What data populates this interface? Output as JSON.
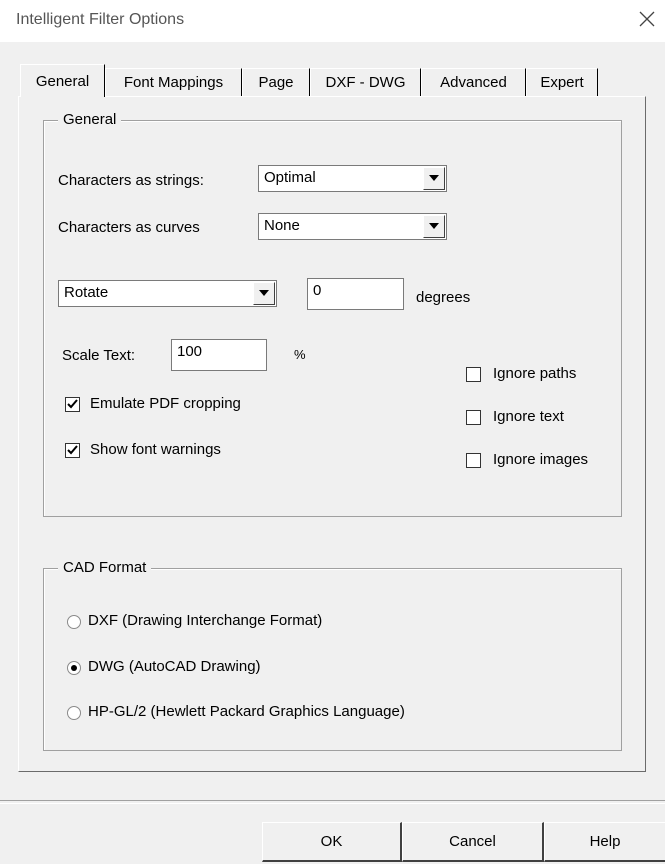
{
  "window": {
    "title": "Intelligent Filter Options"
  },
  "tabs": [
    {
      "label": "General",
      "active": true
    },
    {
      "label": "Font Mappings"
    },
    {
      "label": "Page"
    },
    {
      "label": "DXF - DWG"
    },
    {
      "label": "Advanced"
    },
    {
      "label": "Expert"
    }
  ],
  "general_group": {
    "title": "General",
    "chars_as_strings": {
      "label": "Characters as strings:",
      "value": "Optimal"
    },
    "chars_as_curves": {
      "label": "Characters as curves",
      "value": "None"
    },
    "rotate": {
      "value": "Rotate",
      "degrees": "0",
      "unit": "degrees"
    },
    "scale_text": {
      "label": "Scale Text:",
      "value": "100",
      "unit": "%"
    },
    "checks": {
      "emulate_pdf": {
        "label": "Emulate PDF cropping",
        "checked": true
      },
      "font_warnings": {
        "label": "Show font warnings",
        "checked": true
      },
      "ignore_paths": {
        "label": "Ignore paths",
        "checked": false
      },
      "ignore_text": {
        "label": "Ignore text",
        "checked": false
      },
      "ignore_images": {
        "label": "Ignore images",
        "checked": false
      }
    }
  },
  "cad_group": {
    "title": "CAD Format",
    "options": [
      {
        "label": "DXF (Drawing Interchange Format)",
        "selected": false
      },
      {
        "label": "DWG (AutoCAD Drawing)",
        "selected": true
      },
      {
        "label": "HP-GL/2 (Hewlett Packard Graphics Language)",
        "selected": false
      }
    ]
  },
  "buttons": {
    "ok": "OK",
    "cancel": "Cancel",
    "help": "Help"
  },
  "icons": {
    "close": "close-icon",
    "dropdown": "chevron-down-icon",
    "check": "checkmark-icon"
  }
}
